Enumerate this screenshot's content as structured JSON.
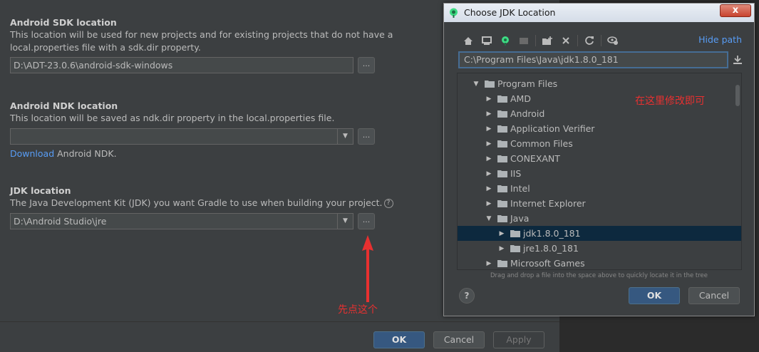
{
  "settings": {
    "sdk": {
      "title": "Android SDK location",
      "desc_line1": "This location will be used for new projects and for existing projects that do not have a",
      "desc_line2": "local.properties file with a sdk.dir property.",
      "value": "D:\\ADT-23.0.6\\android-sdk-windows",
      "browse_label": "..."
    },
    "ndk": {
      "title": "Android NDK location",
      "desc": "This location will be saved as ndk.dir property in the local.properties file.",
      "value": "",
      "browse_label": "...",
      "download_link": "Download",
      "download_suffix": "Android NDK."
    },
    "jdk": {
      "title": "JDK location",
      "desc": "The Java Development Kit (JDK) you want Gradle to use when building your project.",
      "help": "?",
      "value": "D:\\Android Studio\\jre",
      "browse_label": "..."
    },
    "annotation_click_first": "先点这个",
    "buttons": {
      "ok": "OK",
      "cancel": "Cancel",
      "apply": "Apply"
    }
  },
  "dialog": {
    "title": "Choose JDK Location",
    "close_label": "x",
    "hide_path": "Hide path",
    "path": "C:\\Program Files\\Java\\jdk1.8.0_181",
    "annotation_modify": "在这里修改即可",
    "tree": [
      {
        "label": "Program Files",
        "expanded": true,
        "selected": false
      },
      {
        "label": "AMD",
        "expanded": false,
        "selected": false
      },
      {
        "label": "Android",
        "expanded": false,
        "selected": false
      },
      {
        "label": "Application Verifier",
        "expanded": false,
        "selected": false
      },
      {
        "label": "Common Files",
        "expanded": false,
        "selected": false
      },
      {
        "label": "CONEXANT",
        "expanded": false,
        "selected": false
      },
      {
        "label": "IIS",
        "expanded": false,
        "selected": false
      },
      {
        "label": "Intel",
        "expanded": false,
        "selected": false
      },
      {
        "label": "Internet Explorer",
        "expanded": false,
        "selected": false
      },
      {
        "label": "Java",
        "expanded": true,
        "selected": false
      },
      {
        "label": "jdk1.8.0_181",
        "expanded": false,
        "selected": true
      },
      {
        "label": "jre1.8.0_181",
        "expanded": false,
        "selected": false
      },
      {
        "label": "Microsoft Games",
        "expanded": false,
        "selected": false
      }
    ],
    "drag_hint": "Drag and drop a file into the space above to quickly locate it in the tree",
    "help": "?",
    "buttons": {
      "ok": "OK",
      "cancel": "Cancel"
    }
  },
  "colors": {
    "accent": "#589df6",
    "annotation": "#e83030",
    "selection": "#0d293e",
    "primary_button": "#365880"
  }
}
